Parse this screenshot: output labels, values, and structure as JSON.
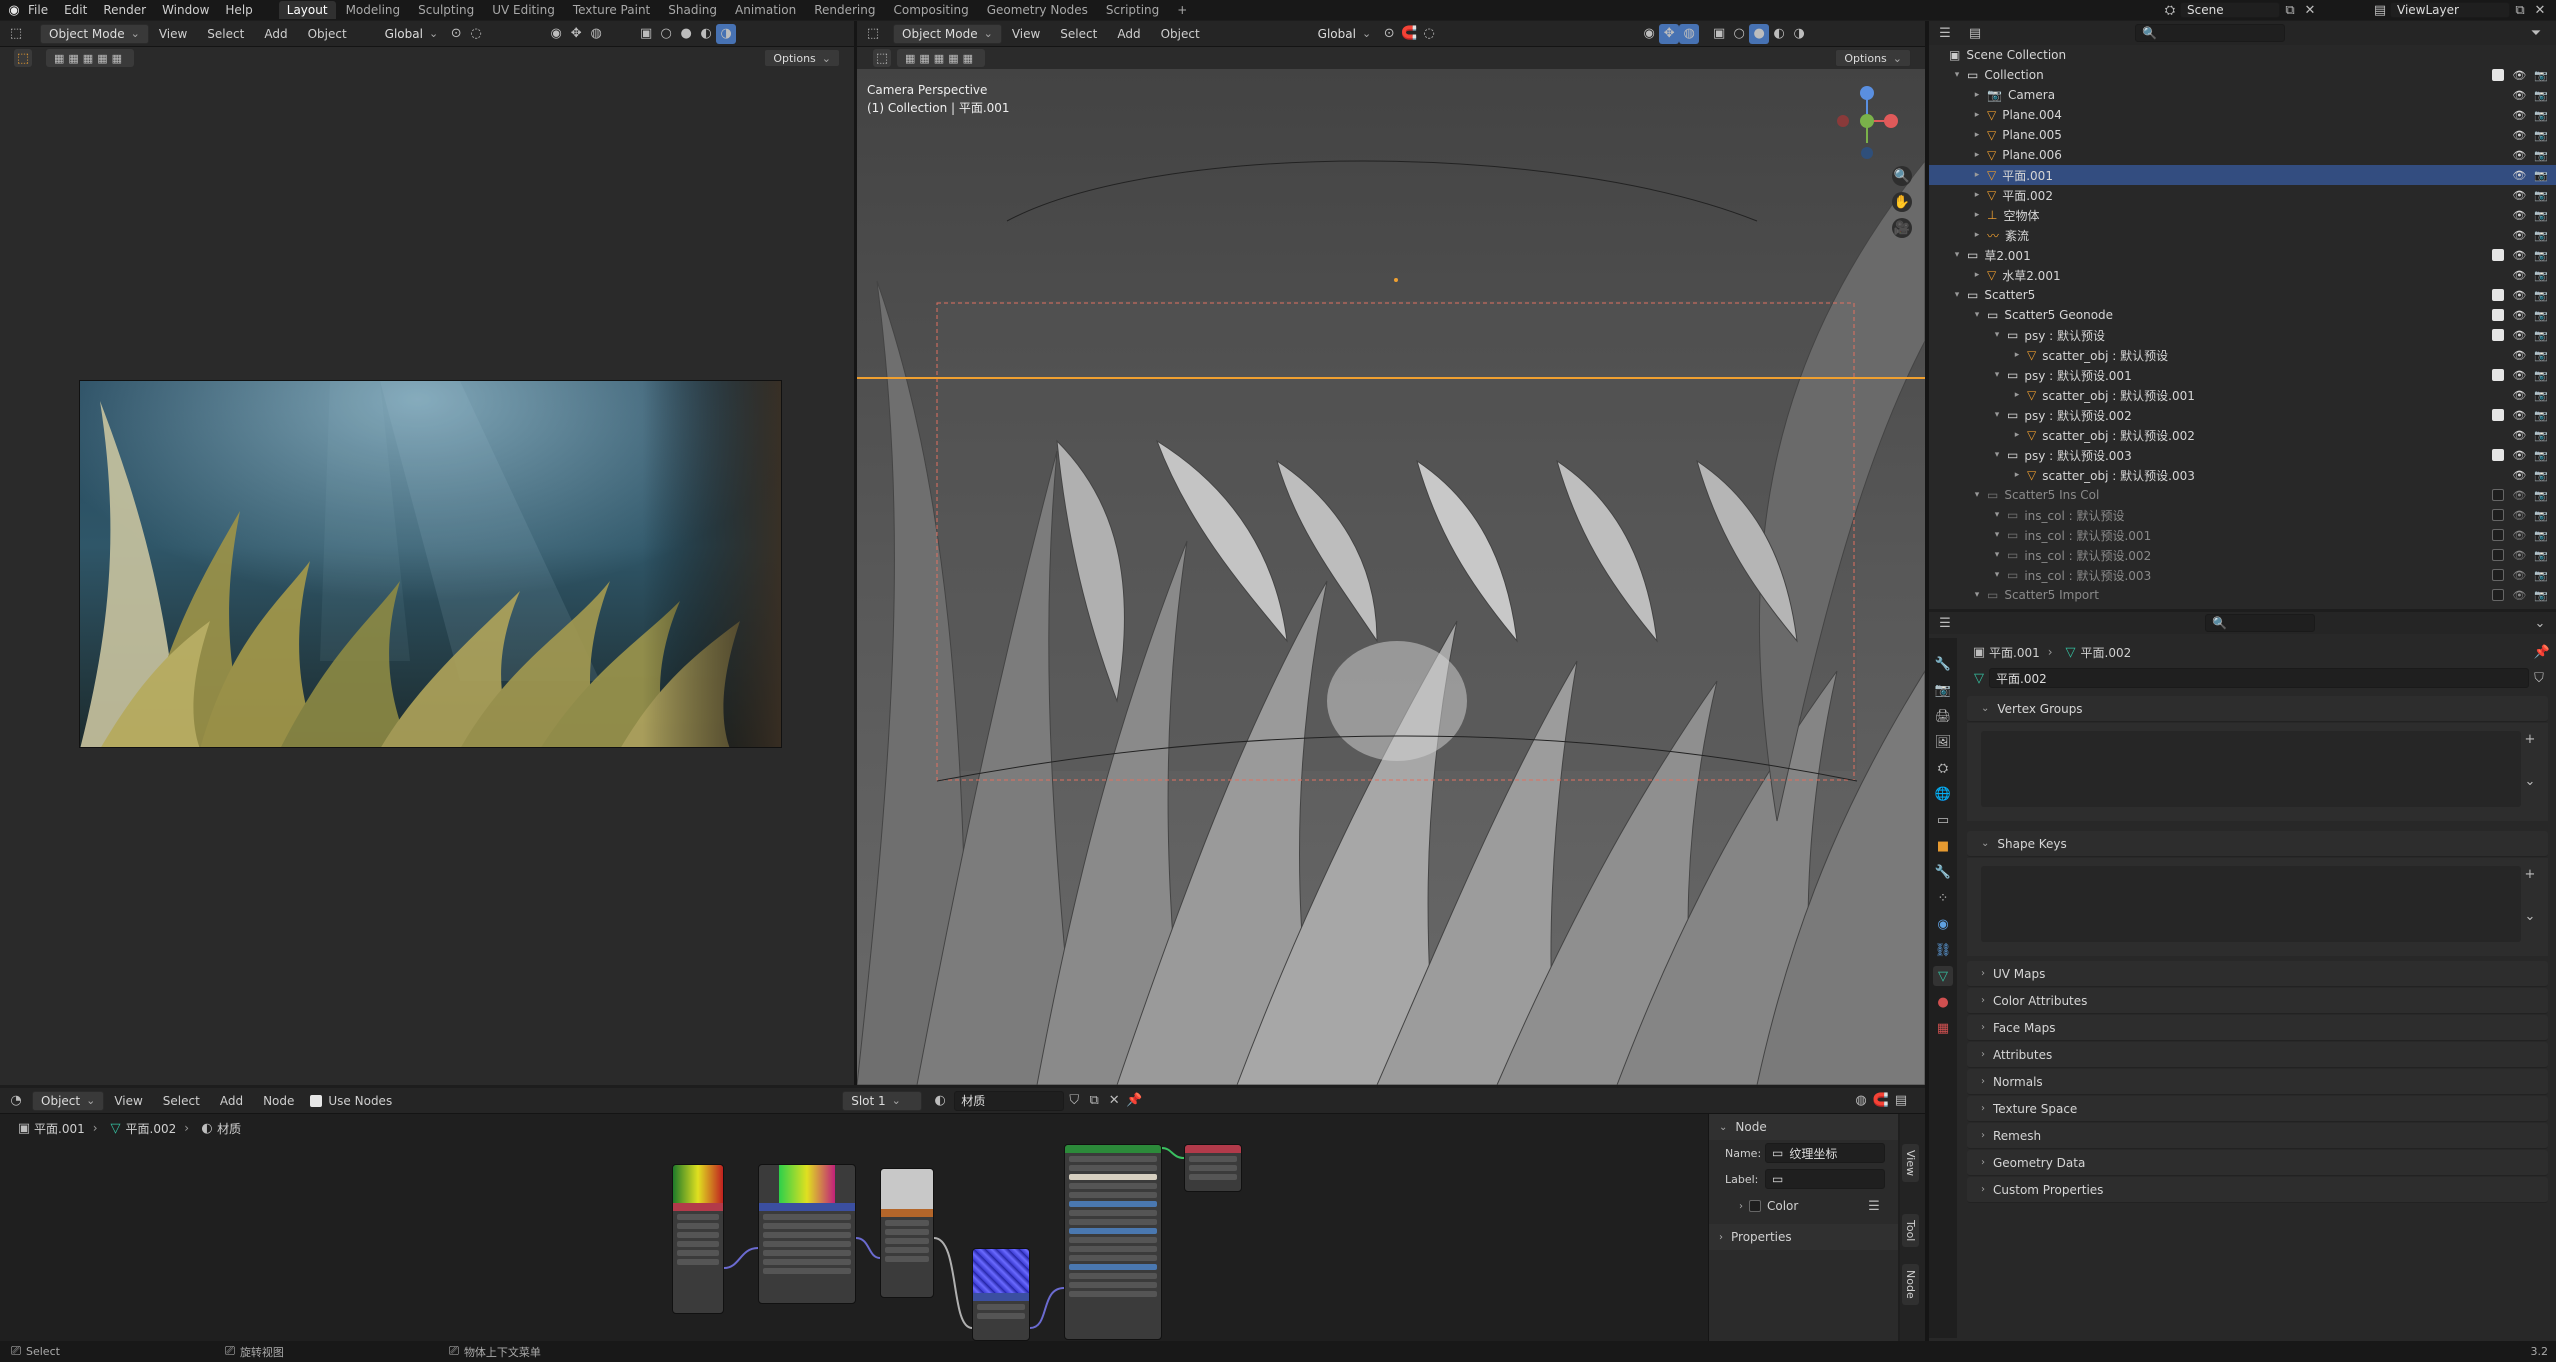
{
  "topbar": {
    "menus": [
      "File",
      "Edit",
      "Render",
      "Window",
      "Help"
    ],
    "workspaces": [
      "Layout",
      "Modeling",
      "Sculpting",
      "UV Editing",
      "Texture Paint",
      "Shading",
      "Animation",
      "Rendering",
      "Compositing",
      "Geometry Nodes",
      "Scripting"
    ],
    "active_workspace": "Layout",
    "add_tab": "+",
    "scene": "Scene",
    "view_layer": "ViewLayer"
  },
  "left_viewport": {
    "mode": "Object Mode",
    "menus": [
      "View",
      "Select",
      "Add",
      "Object"
    ],
    "transform": "Global",
    "options": "Options"
  },
  "right_viewport": {
    "mode": "Object Mode",
    "menus": [
      "View",
      "Select",
      "Add",
      "Object"
    ],
    "transform": "Global",
    "options": "Options",
    "overlay_title": "Camera Perspective",
    "overlay_sub": "(1) Collection | 平面.001"
  },
  "outliner": {
    "root": "Scene Collection",
    "rows": [
      {
        "label": "Collection",
        "depth": 0,
        "type": "collection",
        "checked": true,
        "selected": false,
        "dim": false
      },
      {
        "label": "Camera",
        "depth": 1,
        "type": "camera",
        "checked": false,
        "selected": false,
        "dim": false
      },
      {
        "label": "Plane.004",
        "depth": 1,
        "type": "mesh",
        "checked": false,
        "selected": false,
        "dim": false
      },
      {
        "label": "Plane.005",
        "depth": 1,
        "type": "mesh",
        "checked": false,
        "selected": false,
        "dim": false
      },
      {
        "label": "Plane.006",
        "depth": 1,
        "type": "mesh",
        "checked": false,
        "selected": false,
        "dim": false
      },
      {
        "label": "平面.001",
        "depth": 1,
        "type": "mesh",
        "checked": false,
        "selected": true,
        "dim": false
      },
      {
        "label": "平面.002",
        "depth": 1,
        "type": "mesh",
        "checked": false,
        "selected": false,
        "dim": false
      },
      {
        "label": "空物体",
        "depth": 1,
        "type": "empty",
        "checked": false,
        "selected": false,
        "dim": false
      },
      {
        "label": "紊流",
        "depth": 1,
        "type": "force",
        "checked": false,
        "selected": false,
        "dim": false
      },
      {
        "label": "草2.001",
        "depth": 0,
        "type": "collection",
        "checked": true,
        "selected": false,
        "dim": false
      },
      {
        "label": "水草2.001",
        "depth": 1,
        "type": "mesh",
        "checked": false,
        "selected": false,
        "dim": false
      },
      {
        "label": "Scatter5",
        "depth": 0,
        "type": "collection",
        "checked": true,
        "selected": false,
        "dim": false
      },
      {
        "label": "Scatter5 Geonode",
        "depth": 1,
        "type": "collection",
        "checked": true,
        "selected": false,
        "dim": false
      },
      {
        "label": "psy : 默认预设",
        "depth": 2,
        "type": "collection",
        "checked": true,
        "selected": false,
        "dim": false
      },
      {
        "label": "scatter_obj : 默认预设",
        "depth": 3,
        "type": "mesh",
        "checked": false,
        "selected": false,
        "dim": false
      },
      {
        "label": "psy : 默认预设.001",
        "depth": 2,
        "type": "collection",
        "checked": true,
        "selected": false,
        "dim": false
      },
      {
        "label": "scatter_obj : 默认预设.001",
        "depth": 3,
        "type": "mesh",
        "checked": false,
        "selected": false,
        "dim": false
      },
      {
        "label": "psy : 默认预设.002",
        "depth": 2,
        "type": "collection",
        "checked": true,
        "selected": false,
        "dim": false
      },
      {
        "label": "scatter_obj : 默认预设.002",
        "depth": 3,
        "type": "mesh",
        "checked": false,
        "selected": false,
        "dim": false
      },
      {
        "label": "psy : 默认预设.003",
        "depth": 2,
        "type": "collection",
        "checked": true,
        "selected": false,
        "dim": false
      },
      {
        "label": "scatter_obj : 默认预设.003",
        "depth": 3,
        "type": "mesh",
        "checked": false,
        "selected": false,
        "dim": false
      },
      {
        "label": "Scatter5 Ins Col",
        "depth": 1,
        "type": "collection",
        "checked": false,
        "selected": false,
        "dim": true
      },
      {
        "label": "ins_col : 默认预设",
        "depth": 2,
        "type": "collection",
        "checked": false,
        "selected": false,
        "dim": true
      },
      {
        "label": "ins_col : 默认预设.001",
        "depth": 2,
        "type": "collection",
        "checked": false,
        "selected": false,
        "dim": true
      },
      {
        "label": "ins_col : 默认预设.002",
        "depth": 2,
        "type": "collection",
        "checked": false,
        "selected": false,
        "dim": true
      },
      {
        "label": "ins_col : 默认预设.003",
        "depth": 2,
        "type": "collection",
        "checked": false,
        "selected": false,
        "dim": true
      },
      {
        "label": "Scatter5 Import",
        "depth": 1,
        "type": "collection",
        "checked": false,
        "selected": false,
        "dim": true
      }
    ]
  },
  "properties": {
    "breadcrumb_obj": "平面.001",
    "breadcrumb_data": "平面.002",
    "mesh_name": "平面.002",
    "sections": [
      "UV Maps",
      "Color Attributes",
      "Face Maps",
      "Attributes",
      "Normals",
      "Texture Space",
      "Remesh",
      "Geometry Data",
      "Custom Properties"
    ],
    "vertex_groups": "Vertex Groups",
    "shape_keys": "Shape Keys"
  },
  "node_editor": {
    "editor_type": "Object",
    "menus": [
      "View",
      "Select",
      "Add",
      "Node"
    ],
    "use_nodes": "Use Nodes",
    "slot": "Slot 1",
    "material": "材质",
    "breadcrumb": [
      "平面.001",
      "平面.002",
      "材质"
    ],
    "sidebar": {
      "panel": "Node",
      "name_label": "Name:",
      "name_value": "纹理坐标",
      "label_label": "Label:",
      "label_value": "",
      "color": "Color",
      "properties": "Properties"
    },
    "tabs": [
      "Node",
      "Tool",
      "View"
    ]
  },
  "statusbar": {
    "select": "Select",
    "rotate": "旋转视图",
    "context": "物体上下文菜单",
    "version": "3.2"
  }
}
